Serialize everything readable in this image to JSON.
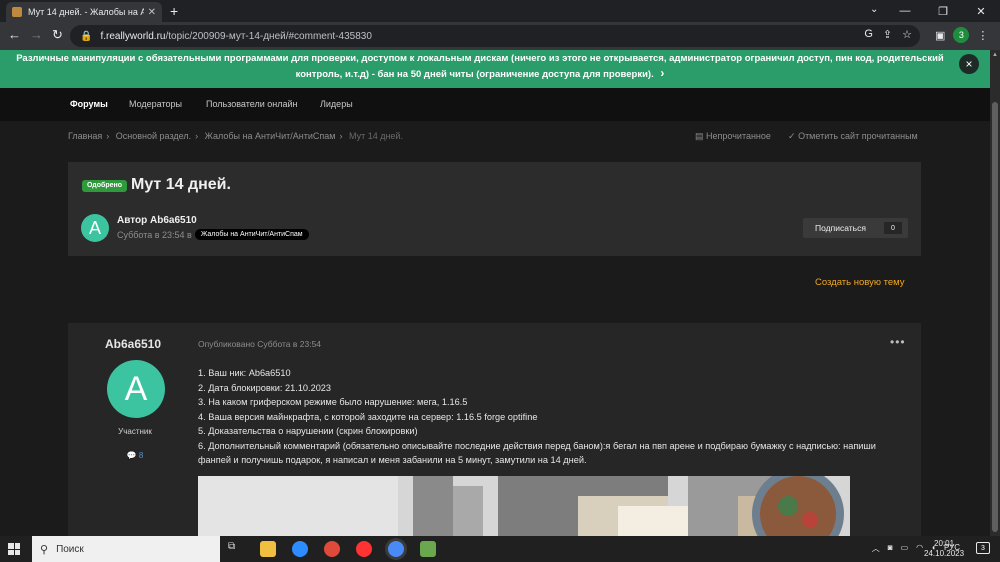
{
  "browser": {
    "tab_title": "Мут 14 дней. - Жалобы на АнтиЧ",
    "url_host": "f.reallyworld.ru",
    "url_path": "/topic/200909-мут-14-дней/#comment-435830",
    "profile_initial": "3"
  },
  "banner": {
    "text": "Различные манипуляции с обязательными программами для проверки, доступом к локальным дискам (ничего из этого не открывается, администратор ограничил доступ, пин код, родительский контроль, и.т.д) - бан на 50 дней читы (ограничение доступа для проверки).",
    "arrow": "›",
    "close": "×"
  },
  "nav": {
    "items": [
      "Форумы",
      "Модераторы",
      "Пользователи онлайн",
      "Лидеры"
    ]
  },
  "breadcrumb": {
    "items": [
      "Главная",
      "Основной раздел.",
      "Жалобы на АнтиЧит/АнтиСпам",
      "Мут 14 дней."
    ],
    "unread": "Непрочитанное",
    "mark_read": "Отметить сайт прочитанным"
  },
  "topic": {
    "badge": "Одобрено",
    "title": "Мут 14 дней.",
    "author_initial": "A",
    "author_line": "Автор Ab6a6510",
    "date_line": "Суббота в 23:54 в",
    "forum_tag": "Жалобы на АнтиЧит/АнтиСпам",
    "subscribe_label": "Подписаться",
    "subscribe_count": "0"
  },
  "new_topic_label": "Создать новую тему",
  "post": {
    "author": "Ab6a6510",
    "avatar_initial": "A",
    "rank": "Участник",
    "rep": "8",
    "meta": "Опубликовано Суббота в 23:54",
    "lines": [
      "1. Ваш ник: Ab6a6510",
      "2. Дата блокировки: 21.10.2023",
      "3. На каком гриферском режиме было нарушение: мега, 1.16.5",
      "4. Ваша версия майнкрафта, с которой заходите на сервер: 1.16.5 forge optifine",
      "5. Доказательства о нарушении (скрин блокировки)",
      "6. Дополнительный комментарий (обязательно описывайте последние действия перед баном):я бегал на пвп арене и подбираю бумажку с надписью: напиши фанпей и получишь подарок, я написал и меня забанили на 5 минут, замутили на 14 дней."
    ]
  },
  "taskbar": {
    "search": "Поиск",
    "lang": "РУС",
    "time": "20:01",
    "date": "24.10.2023",
    "notif_count": "3"
  }
}
